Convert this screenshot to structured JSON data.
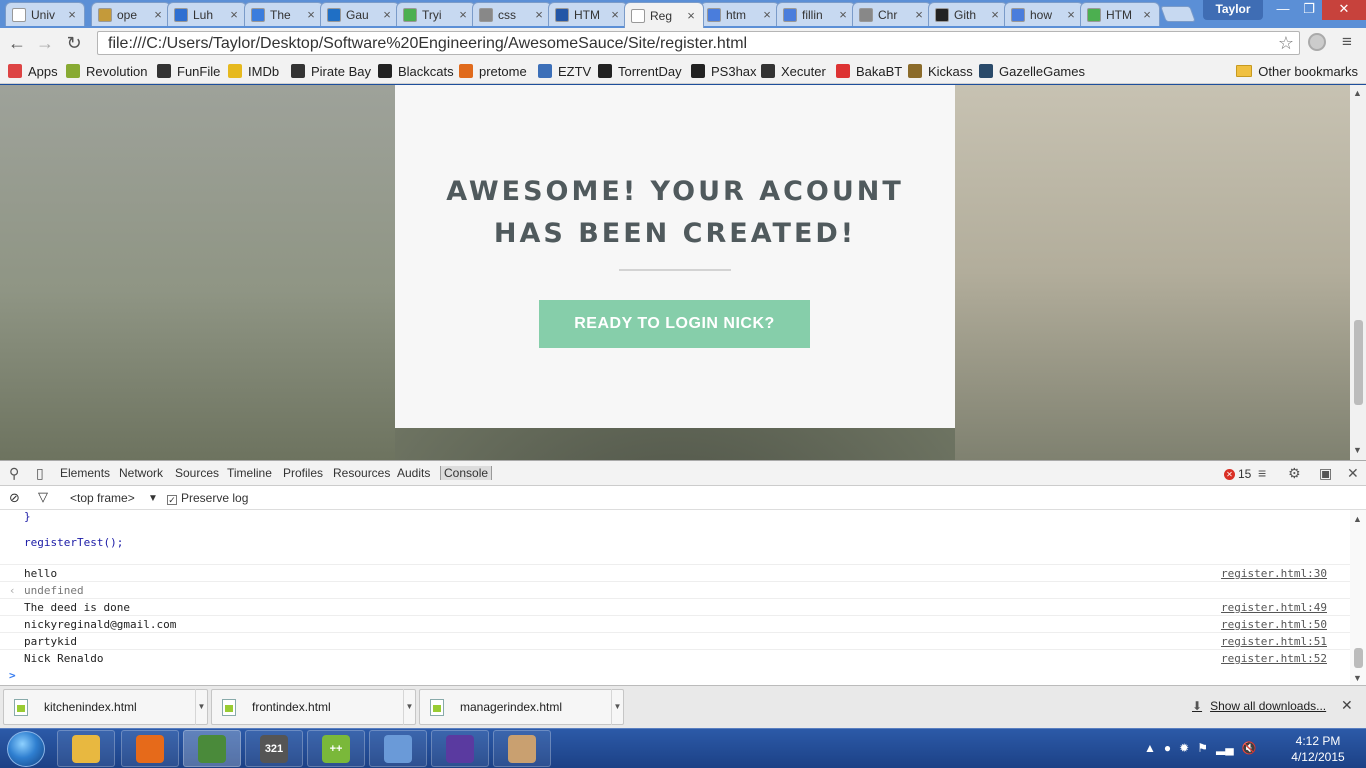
{
  "browser": {
    "tabs": [
      {
        "label": "Univ",
        "icon": "page-icon",
        "color": "#ffffff",
        "active": false
      },
      {
        "label": "ope",
        "icon": "library-icon",
        "color": "#c49a3a",
        "active": false
      },
      {
        "label": "Luh",
        "icon": "home-icon",
        "color": "#2e6fd1",
        "active": false
      },
      {
        "label": "The",
        "icon": "shield-icon",
        "color": "#3b7ddd",
        "active": false
      },
      {
        "label": "Gau",
        "icon": "outlook-icon",
        "color": "#1f6fc5",
        "active": false
      },
      {
        "label": "Tryi",
        "icon": "w3-icon",
        "color": "#4caf50",
        "active": false
      },
      {
        "label": "css",
        "icon": "globe-icon",
        "color": "#888888",
        "active": false
      },
      {
        "label": "HTM",
        "icon": "hg-icon",
        "color": "#2356a6",
        "active": false
      },
      {
        "label": "Reg",
        "icon": "page-icon",
        "color": "#ffffff",
        "active": true
      },
      {
        "label": "htm",
        "icon": "google-icon",
        "color": "#4a7ddc",
        "active": false
      },
      {
        "label": "fillin",
        "icon": "google-icon",
        "color": "#4a7ddc",
        "active": false
      },
      {
        "label": "Chr",
        "icon": "globe-icon",
        "color": "#888888",
        "active": false
      },
      {
        "label": "Gith",
        "icon": "github-icon",
        "color": "#222222",
        "active": false
      },
      {
        "label": "how",
        "icon": "google-icon",
        "color": "#4a7ddc",
        "active": false
      },
      {
        "label": "HTM",
        "icon": "w3-icon",
        "color": "#4caf50",
        "active": false
      }
    ],
    "profile_name": "Taylor",
    "url": "file:///C:/Users/Taylor/Desktop/Software%20Engineering/AwesomeSauce/Site/register.html",
    "bookmarks": [
      {
        "label": "Apps",
        "icon": "apps-grid-icon",
        "color": "#d44"
      },
      {
        "label": "Revolution",
        "icon": "revolution-icon",
        "color": "#8a3"
      },
      {
        "label": "FunFile",
        "icon": "funfile-icon",
        "color": "#333"
      },
      {
        "label": "IMDb",
        "icon": "imdb-icon",
        "color": "#e6b91e"
      },
      {
        "label": "Pirate Bay",
        "icon": "pirate-ship-icon",
        "color": "#333"
      },
      {
        "label": "Blackcats",
        "icon": "paw-icon",
        "color": "#222"
      },
      {
        "label": "pretome",
        "icon": "pretome-icon",
        "color": "#e06a1c"
      },
      {
        "label": "EZTV",
        "icon": "eztv-icon",
        "color": "#3c6fb8"
      },
      {
        "label": "TorrentDay",
        "icon": "torrentday-icon",
        "color": "#222"
      },
      {
        "label": "PS3hax",
        "icon": "ps3hax-icon",
        "color": "#222"
      },
      {
        "label": "Xecuter",
        "icon": "xecuter-icon",
        "color": "#333"
      },
      {
        "label": "BakaBT",
        "icon": "bakabt-icon",
        "color": "#d33"
      },
      {
        "label": "Kickass",
        "icon": "kickass-icon",
        "color": "#8b6b2a"
      },
      {
        "label": "GazelleGames",
        "icon": "gazellegames-icon",
        "color": "#2a4a6a"
      }
    ],
    "other_bookmarks": "Other bookmarks"
  },
  "page": {
    "title_line1": "AWESOME! YOUR ACOUNT",
    "title_line2": "HAS BEEN CREATED!",
    "button_label": "READY TO LOGIN NICK?",
    "accent_color": "#86ceaa"
  },
  "devtools": {
    "tabs": [
      "Elements",
      "Network",
      "Sources",
      "Timeline",
      "Profiles",
      "Resources",
      "Audits",
      "Console"
    ],
    "active_tab": "Console",
    "error_count": "15",
    "frame_select": "<top frame>",
    "preserve_log": "Preserve log",
    "console_lines": [
      {
        "text": "}",
        "kind": "code",
        "source": ""
      },
      {
        "text": "registerTest();",
        "kind": "code",
        "source": ""
      },
      {
        "text": "hello",
        "kind": "out",
        "source": "register.html:30"
      },
      {
        "text": "undefined",
        "kind": "ret",
        "source": ""
      },
      {
        "text": "The deed is done",
        "kind": "out",
        "source": "register.html:49"
      },
      {
        "text": "nickyreginald@gmail.com",
        "kind": "out",
        "source": "register.html:50"
      },
      {
        "text": "partykid",
        "kind": "out",
        "source": "register.html:51"
      },
      {
        "text": "Nick Renaldo",
        "kind": "out",
        "source": "register.html:52"
      }
    ],
    "prompt": ">"
  },
  "downloads": {
    "items": [
      "kitchenindex.html",
      "frontindex.html",
      "managerindex.html"
    ],
    "show_all": "Show all downloads..."
  },
  "taskbar": {
    "apps": [
      {
        "name": "explorer-icon",
        "label": "",
        "color": "#e8b840"
      },
      {
        "name": "firefox-icon",
        "label": "",
        "color": "#e66a1a"
      },
      {
        "name": "chrome-icon",
        "label": "",
        "color": "#4a8a3a"
      },
      {
        "name": "calendar-321-icon",
        "label": "321",
        "color": "#555555"
      },
      {
        "name": "notepad-plus-icon",
        "label": "++",
        "color": "#7ab83a"
      },
      {
        "name": "control-panel-icon",
        "label": "",
        "color": "#6a9ad8"
      },
      {
        "name": "cat-app-icon",
        "label": "",
        "color": "#5a3aa0"
      },
      {
        "name": "paint-icon",
        "label": "",
        "color": "#c9a070"
      }
    ],
    "time": "4:12 PM",
    "date": "4/12/2015"
  }
}
